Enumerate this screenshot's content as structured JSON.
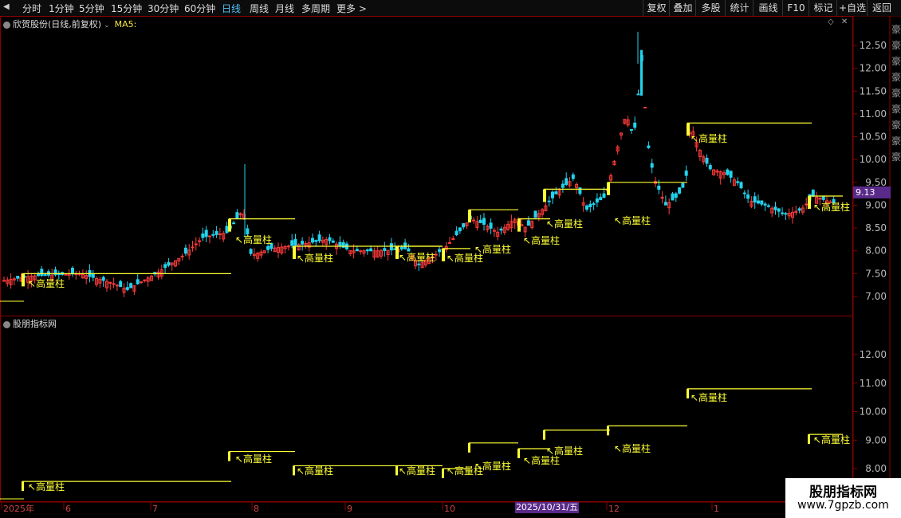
{
  "topbar": {
    "timeframes": [
      "分时",
      "1分钟",
      "5分钟",
      "15分钟",
      "30分钟",
      "60分钟",
      "日线",
      "周线",
      "月线",
      "多周期",
      "更多 >"
    ],
    "active": "日线",
    "right_buttons": [
      "复权",
      "叠加",
      "多股",
      "统计",
      "画线",
      "F10",
      "标记",
      "+自选",
      "返回"
    ]
  },
  "main_panel": {
    "title": "欣贺股份(日线,前复权)",
    "ma_label": "MA5:",
    "price_axis": [
      "12.50",
      "12.00",
      "11.50",
      "11.00",
      "10.50",
      "10.00",
      "9.50",
      "9.00",
      "8.50",
      "8.00",
      "7.50",
      "7.00"
    ],
    "current_price": "9.13"
  },
  "sub_panel": {
    "title": "股朋指标网",
    "axis": [
      "12.00",
      "11.00",
      "10.00",
      "9.00",
      "8.00"
    ]
  },
  "annotation_label": "高量柱",
  "date_axis": [
    "2025年",
    "6",
    "7",
    "8",
    "9",
    "10",
    "12",
    "1"
  ],
  "crosshair_date": "2025/10/31/五",
  "watermark": {
    "line1": "股朋指标网",
    "line2": "www.7gpzb.com"
  },
  "colors": {
    "up": "#ff3b3b",
    "down": "#22d3ee",
    "marker": "#ffff33",
    "axis": "#8b0000"
  }
}
